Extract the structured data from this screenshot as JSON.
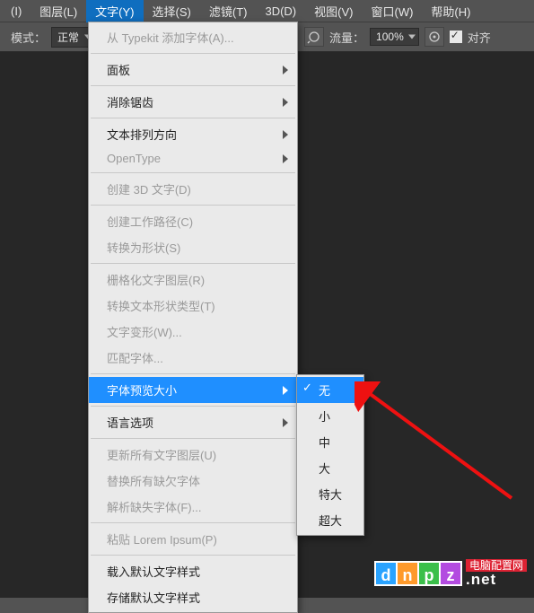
{
  "menubar": {
    "items": [
      {
        "label": "(I)"
      },
      {
        "label": "图层(L)"
      },
      {
        "label": "文字(Y)",
        "active": true
      },
      {
        "label": "选择(S)"
      },
      {
        "label": "滤镜(T)"
      },
      {
        "label": "3D(D)"
      },
      {
        "label": "视图(V)"
      },
      {
        "label": "窗口(W)"
      },
      {
        "label": "帮助(H)"
      }
    ]
  },
  "toolbar": {
    "mode_label": "模式：",
    "mode_value": "正常",
    "flow_label": "流量：",
    "flow_value": "100%",
    "align_label": "对齐"
  },
  "dropdown": {
    "groups": [
      [
        {
          "label": "从 Typekit 添加字体(A)...",
          "disabled": true
        }
      ],
      [
        {
          "label": "面板",
          "sub": true
        }
      ],
      [
        {
          "label": "消除锯齿",
          "sub": true
        }
      ],
      [
        {
          "label": "文本排列方向",
          "sub": true
        },
        {
          "label": "OpenType",
          "sub": true,
          "disabled": true
        }
      ],
      [
        {
          "label": "创建 3D 文字(D)",
          "disabled": true
        }
      ],
      [
        {
          "label": "创建工作路径(C)",
          "disabled": true
        },
        {
          "label": "转换为形状(S)",
          "disabled": true
        }
      ],
      [
        {
          "label": "栅格化文字图层(R)",
          "disabled": true
        },
        {
          "label": "转换文本形状类型(T)",
          "disabled": true
        },
        {
          "label": "文字变形(W)...",
          "disabled": true
        },
        {
          "label": "匹配字体...",
          "disabled": true
        }
      ],
      [
        {
          "label": "字体预览大小",
          "sub": true,
          "highlight": true
        }
      ],
      [
        {
          "label": "语言选项",
          "sub": true
        }
      ],
      [
        {
          "label": "更新所有文字图层(U)",
          "disabled": true
        },
        {
          "label": "替换所有缺欠字体",
          "disabled": true
        },
        {
          "label": "解析缺失字体(F)...",
          "disabled": true
        }
      ],
      [
        {
          "label": "粘贴 Lorem Ipsum(P)",
          "disabled": true
        }
      ],
      [
        {
          "label": "载入默认文字样式"
        },
        {
          "label": "存储默认文字样式"
        }
      ]
    ]
  },
  "submenu": {
    "items": [
      {
        "label": "无",
        "selected": true,
        "highlight": true
      },
      {
        "label": "小"
      },
      {
        "label": "中"
      },
      {
        "label": "大"
      },
      {
        "label": "特大"
      },
      {
        "label": "超大"
      }
    ]
  },
  "watermark": {
    "logo_chars": [
      "d",
      "n",
      "p",
      "z"
    ],
    "cn": "电脑配置网",
    "en": ".net"
  }
}
